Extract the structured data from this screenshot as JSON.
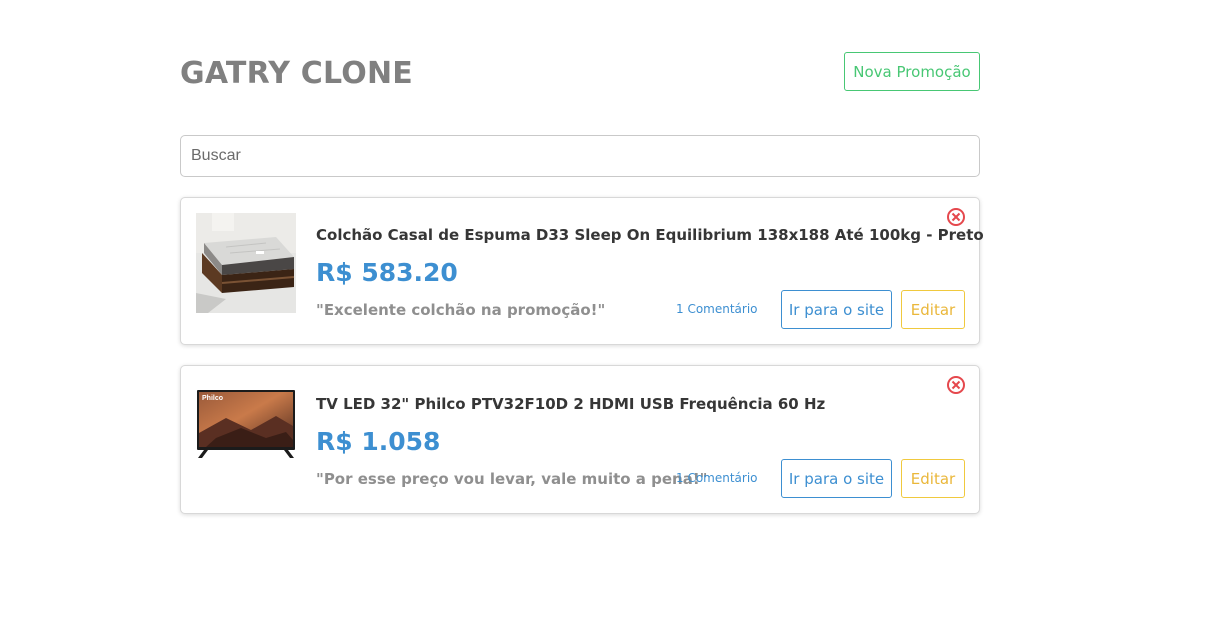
{
  "header": {
    "title": "GATRY CLONE",
    "new_button_label": "Nova Promoção"
  },
  "search": {
    "placeholder": "Buscar",
    "value": ""
  },
  "colors": {
    "title_gray": "#808080",
    "success_green": "#48c774",
    "link_blue": "#3d8fd1",
    "warning_yellow": "#f0c93e",
    "danger_red": "#e5484d"
  },
  "promotions": [
    {
      "title": "Colchão Casal de Espuma D33 Sleep On Equilibrium 138x188 Até 100kg - Preto",
      "price": "R$ 583.20",
      "comment": "\"Excelente colchão na promoção!\"",
      "comment_count": "1 Comentário",
      "site_button": "Ir para o site",
      "edit_button": "Editar",
      "image_icon": "mattress-image",
      "delete_icon": "close-circle-icon"
    },
    {
      "title": "TV LED 32\" Philco PTV32F10D 2 HDMI USB Frequência 60 Hz",
      "price": "R$ 1.058",
      "comment": "\"Por esse preço vou levar, vale muito a pena!\"",
      "comment_count": "1 Comentário",
      "site_button": "Ir para o site",
      "edit_button": "Editar",
      "image_icon": "tv-image",
      "image_brand": "Philco",
      "delete_icon": "close-circle-icon"
    }
  ]
}
